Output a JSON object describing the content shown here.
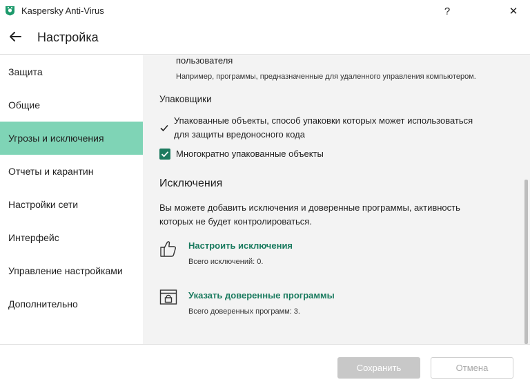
{
  "window": {
    "title": "Kaspersky Anti-Virus",
    "help_label": "?",
    "close_label": "✕"
  },
  "header": {
    "title": "Настройка"
  },
  "sidebar": {
    "items": [
      {
        "label": "Защита"
      },
      {
        "label": "Общие"
      },
      {
        "label": "Угрозы и исключения",
        "active": true
      },
      {
        "label": "Отчеты и карантин"
      },
      {
        "label": "Настройки сети"
      },
      {
        "label": "Интерфейс"
      },
      {
        "label": "Управление настройками"
      },
      {
        "label": "Дополнительно"
      }
    ]
  },
  "main": {
    "partial_heading": "пользователя",
    "partial_desc": "Например, программы, предназначенные для удаленного управления компьютером.",
    "packers": {
      "heading": "Упаковщики",
      "item1_line1": "Упакованные объекты, способ упаковки которых может использоваться",
      "item1_line2": "для защиты вредоносного кода",
      "item1_checked": true,
      "item2_label": "Многократно упакованные объекты",
      "item2_checked": true
    },
    "exclusions": {
      "heading": "Исключения",
      "desc_line1": "Вы можете добавить исключения и доверенные программы, активность",
      "desc_line2": "которых не будет контролироваться.",
      "configure_link": "Настроить исключения",
      "configure_sub": "Всего исключений: 0.",
      "trusted_link": "Указать доверенные программы",
      "trusted_sub": "Всего доверенных программ: 3."
    }
  },
  "footer": {
    "save_label": "Сохранить",
    "cancel_label": "Отмена"
  },
  "colors": {
    "accent": "#1d7a5f",
    "active_nav": "#7fd4b6",
    "link": "#197a5e"
  },
  "icons": [
    "kaspersky-logo-icon",
    "back-arrow-icon",
    "checkmark-icon",
    "checkbox-checked-icon",
    "thumbs-up-icon",
    "trusted-app-lock-icon"
  ]
}
